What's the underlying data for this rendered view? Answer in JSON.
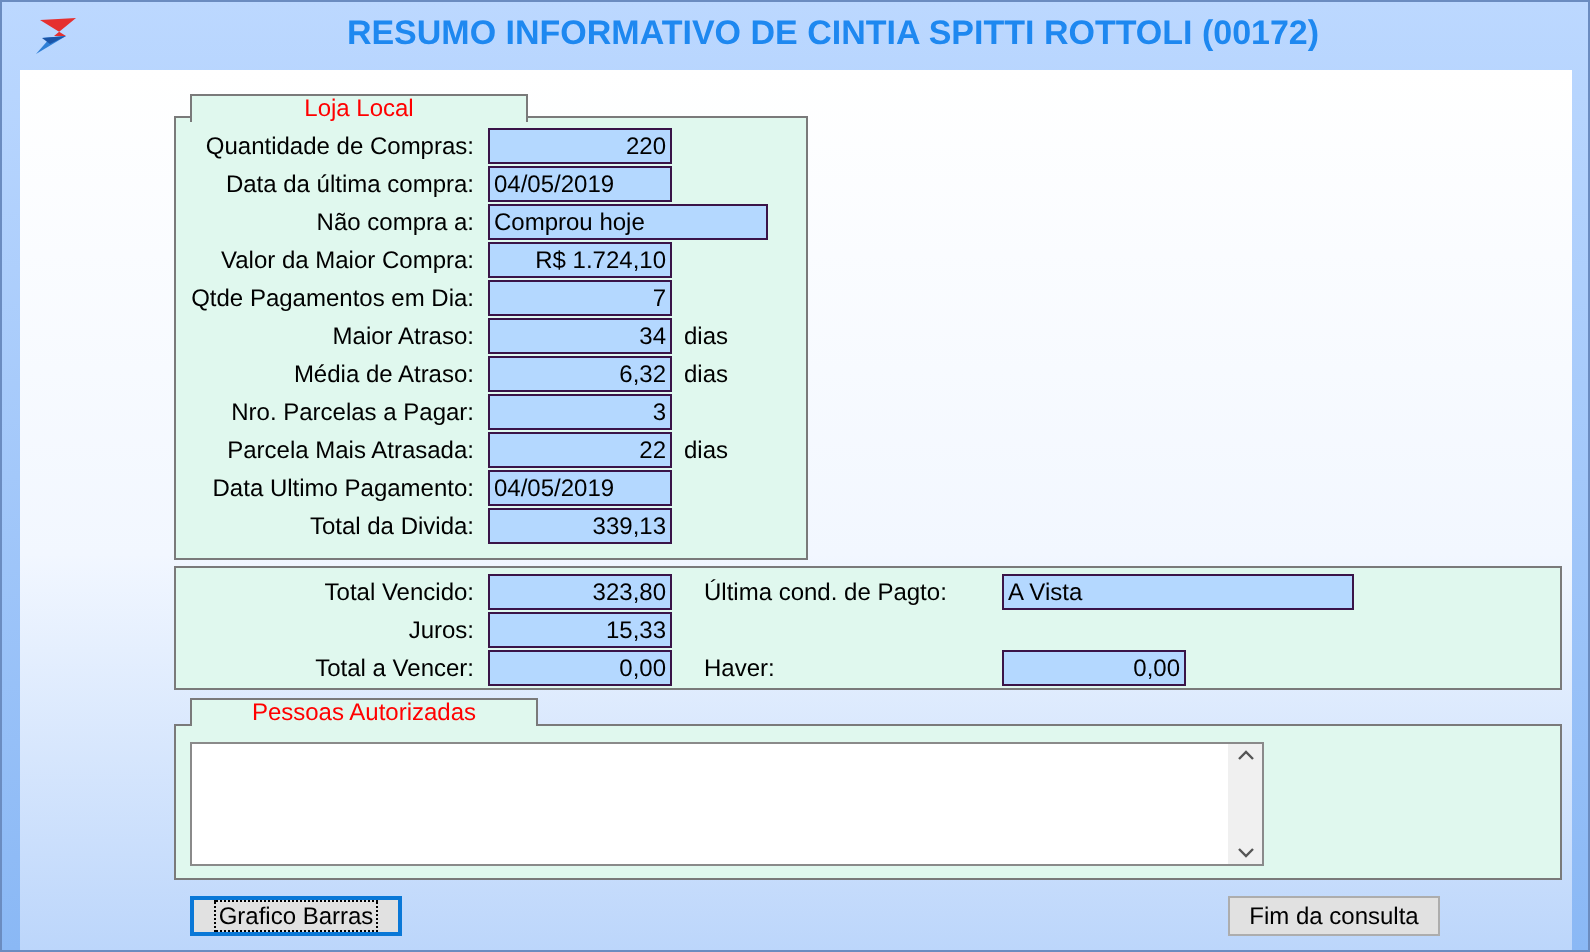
{
  "window": {
    "title": "RESUMO INFORMATIVO DE CINTIA SPITTI ROTTOLI (00172)"
  },
  "loja_local": {
    "title": "Loja Local",
    "rows": [
      {
        "label": "Quantidade de Compras:",
        "value": "220",
        "kind": "number"
      },
      {
        "label": "Data da última compra:",
        "value": "04/05/2019",
        "kind": "text"
      },
      {
        "label": "Não compra a:",
        "value": "Comprou hoje",
        "kind": "longtext"
      },
      {
        "label": "Valor da Maior Compra:",
        "value": "R$ 1.724,10",
        "kind": "number"
      },
      {
        "label": "Qtde Pagamentos em Dia:",
        "value": "7",
        "kind": "number"
      },
      {
        "label": "Maior Atraso:",
        "value": "34",
        "kind": "number",
        "unit": "dias"
      },
      {
        "label": "Média de Atraso:",
        "value": "6,32",
        "kind": "number",
        "unit": "dias"
      },
      {
        "label": "Nro. Parcelas a Pagar:",
        "value": "3",
        "kind": "number"
      },
      {
        "label": "Parcela Mais Atrasada:",
        "value": "22",
        "kind": "number",
        "unit": "dias"
      },
      {
        "label": "Data Ultimo Pagamento:",
        "value": "04/05/2019",
        "kind": "text"
      },
      {
        "label": "Total da Divida:",
        "value": "339,13",
        "kind": "number"
      }
    ]
  },
  "totals": {
    "rows": [
      {
        "items": [
          {
            "label": "Total Vencido:",
            "value": "323,80",
            "kind": "number"
          },
          {
            "label": "Última cond. de Pagto:",
            "value": "A Vista",
            "kind": "longtext"
          }
        ]
      },
      {
        "items": [
          {
            "label": "Juros:",
            "value": "15,33",
            "kind": "number"
          }
        ]
      },
      {
        "items": [
          {
            "label": "Total a Vencer:",
            "value": "0,00",
            "kind": "number"
          },
          {
            "label": "Haver:",
            "value": "0,00",
            "kind": "number"
          }
        ]
      }
    ]
  },
  "pessoas_autorizadas": {
    "title": "Pessoas Autorizadas"
  },
  "buttons": [
    {
      "label": "Grafico Barras",
      "focused": true
    },
    {
      "label": "Fim da consulta",
      "focused": false
    }
  ]
}
